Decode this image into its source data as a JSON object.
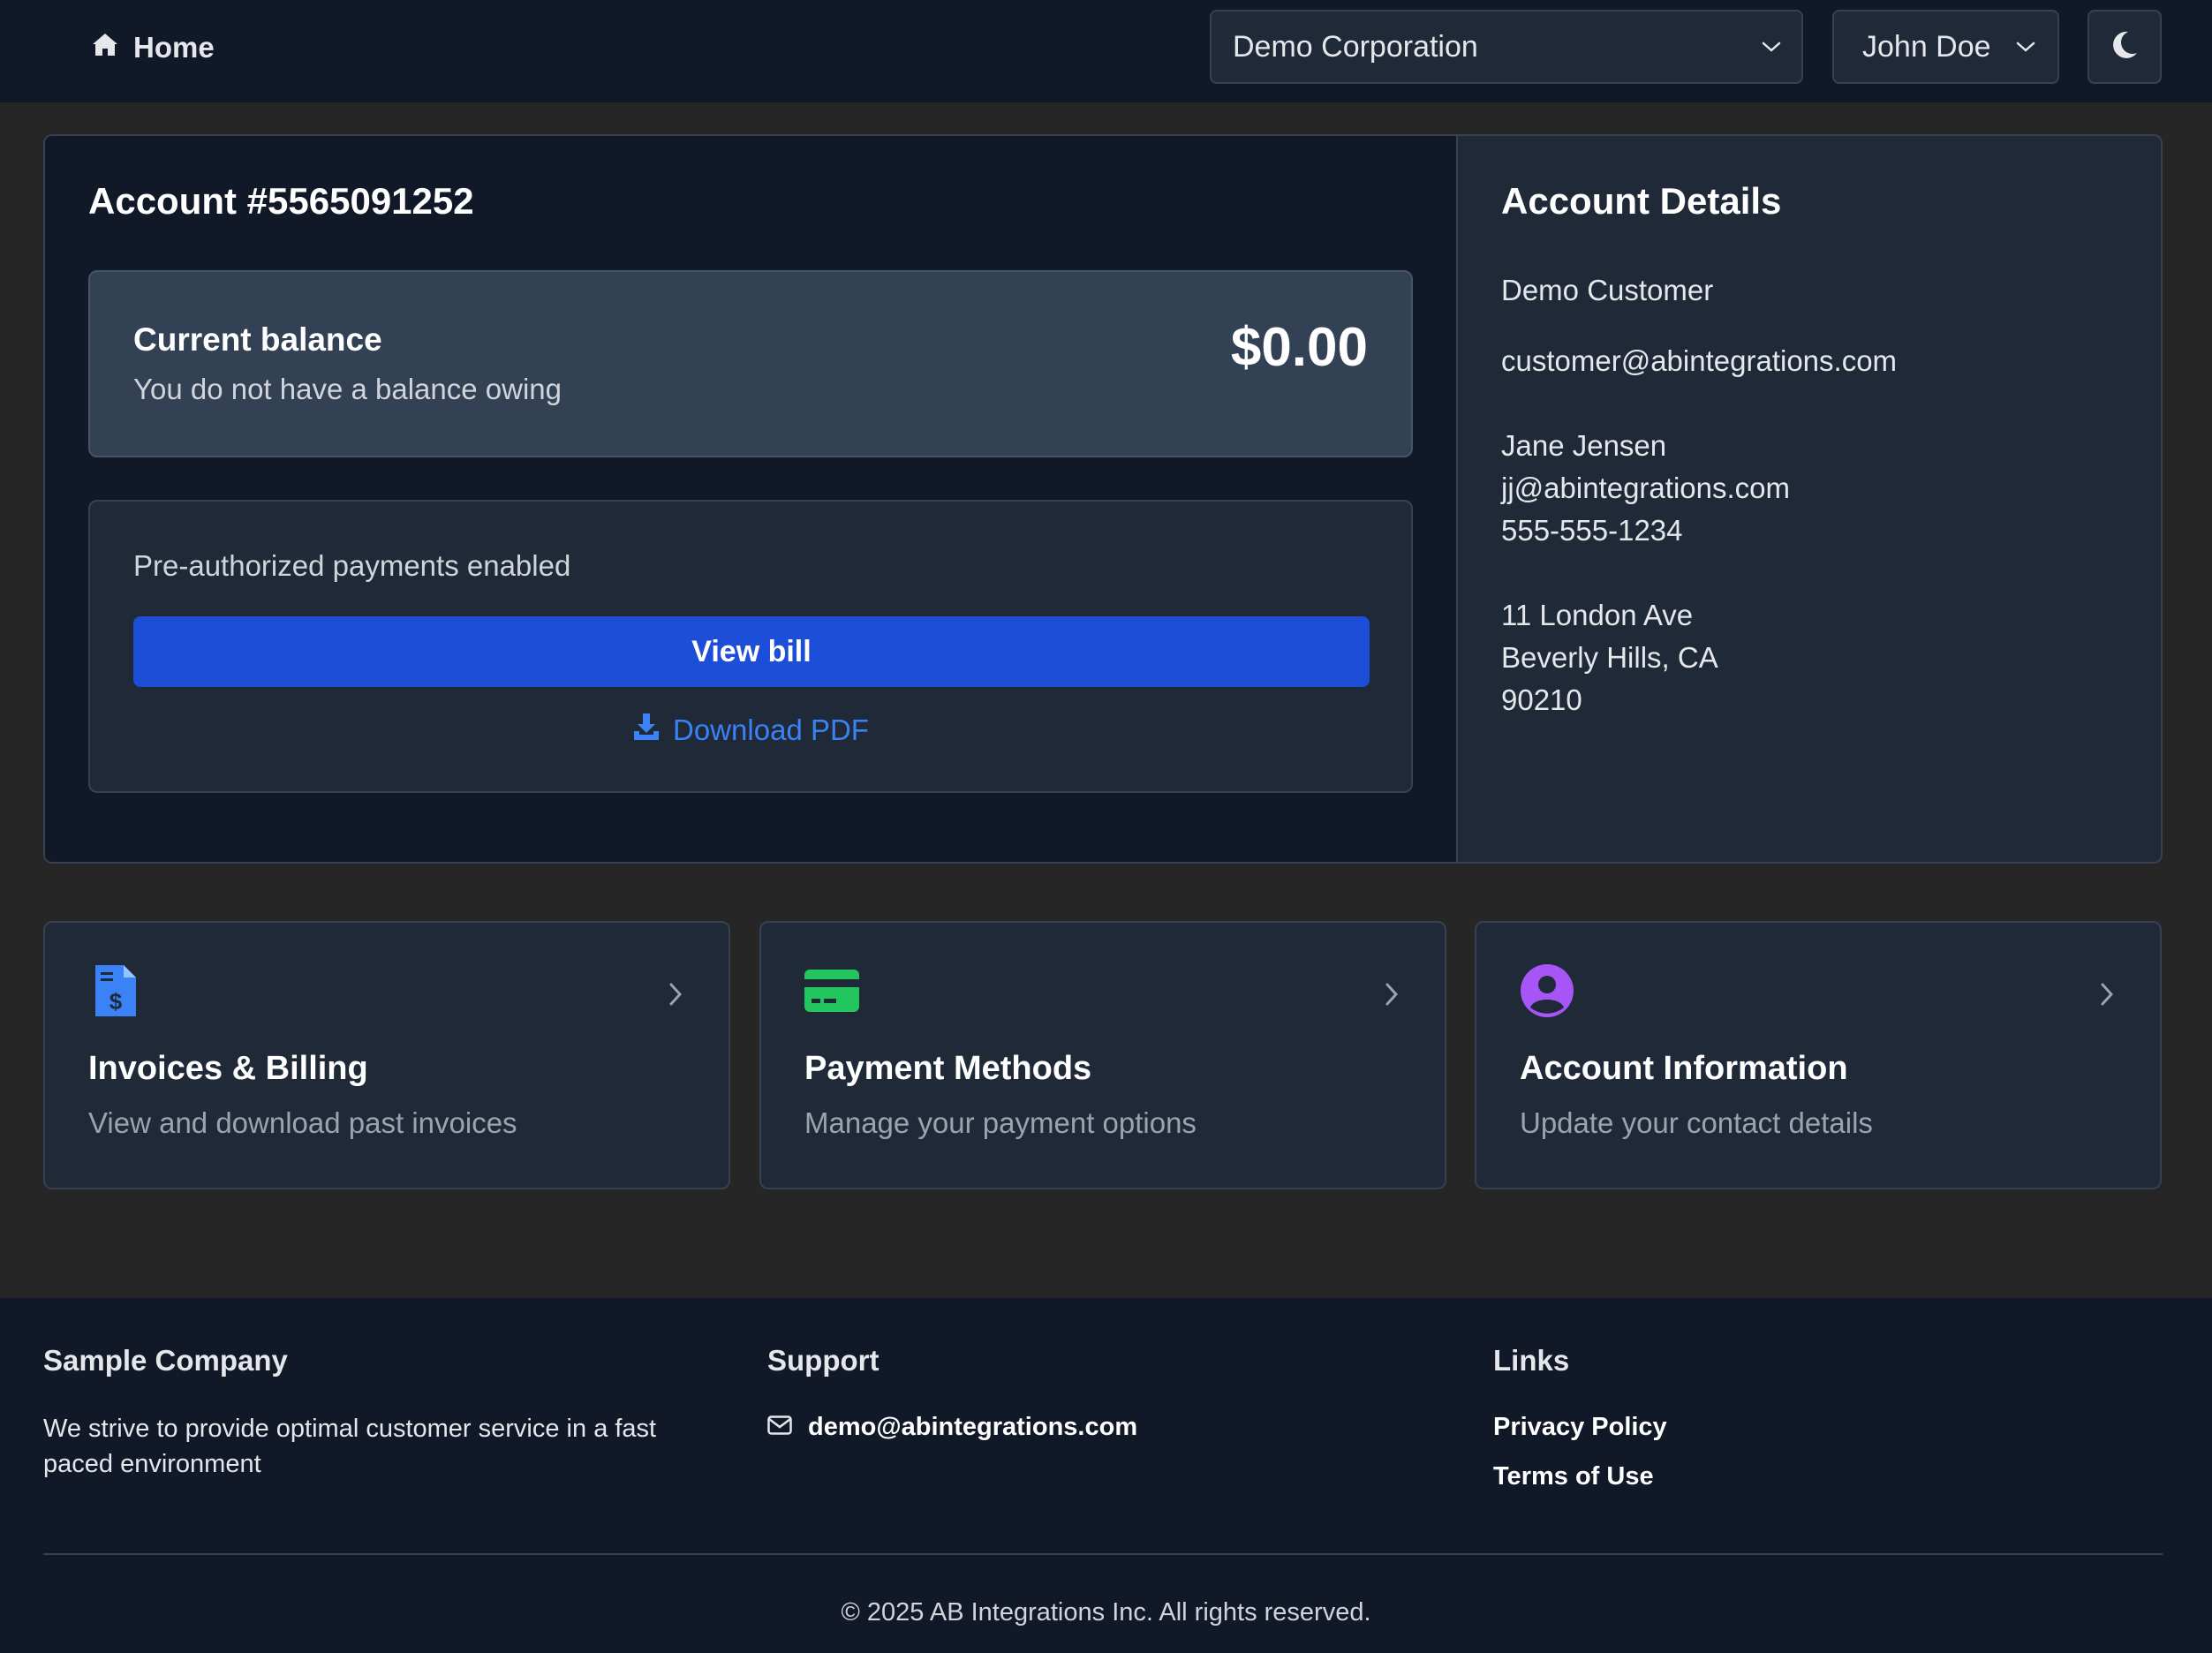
{
  "header": {
    "home_label": "Home",
    "organization": "Demo Corporation",
    "user": "John Doe",
    "icons": {
      "home": "home-icon",
      "dropdown": "chevron-down-icon",
      "theme": "moon-icon"
    }
  },
  "account": {
    "title": "Account #5565091252",
    "balance": {
      "label": "Current balance",
      "subtitle": "You do not have a balance owing",
      "amount": "$0.00"
    },
    "payments": {
      "status": "Pre-authorized payments enabled",
      "view_bill_label": "View bill",
      "download_label": "Download PDF"
    }
  },
  "details": {
    "title": "Account Details",
    "customer_name": "Demo Customer",
    "customer_email": "customer@abintegrations.com",
    "contact_name": "Jane Jensen",
    "contact_email": "jj@abintegrations.com",
    "contact_phone": "555-555-1234",
    "address_line1": "11 London Ave",
    "address_line2": "Beverly Hills, CA",
    "address_line3": "90210"
  },
  "cards": [
    {
      "title": "Invoices & Billing",
      "description": "View and download past invoices",
      "icon": "invoice-icon",
      "color": "#3b82f6"
    },
    {
      "title": "Payment Methods",
      "description": "Manage your payment options",
      "icon": "credit-card-icon",
      "color": "#22c55e"
    },
    {
      "title": "Account Information",
      "description": "Update your contact details",
      "icon": "user-circle-icon",
      "color": "#a855f7"
    }
  ],
  "footer": {
    "company_heading": "Sample Company",
    "company_text": "We strive to provide optimal customer service in a fast paced environment",
    "support_heading": "Support",
    "support_email": "demo@abintegrations.com",
    "links_heading": "Links",
    "links": [
      "Privacy Policy",
      "Terms of Use"
    ],
    "copyright": "© 2025 AB Integrations Inc. All rights reserved."
  },
  "colors": {
    "background": "#262626",
    "surface": "#111827",
    "card": "#1f2937",
    "accent": "#1d4ed8",
    "link": "#3b82f6"
  }
}
